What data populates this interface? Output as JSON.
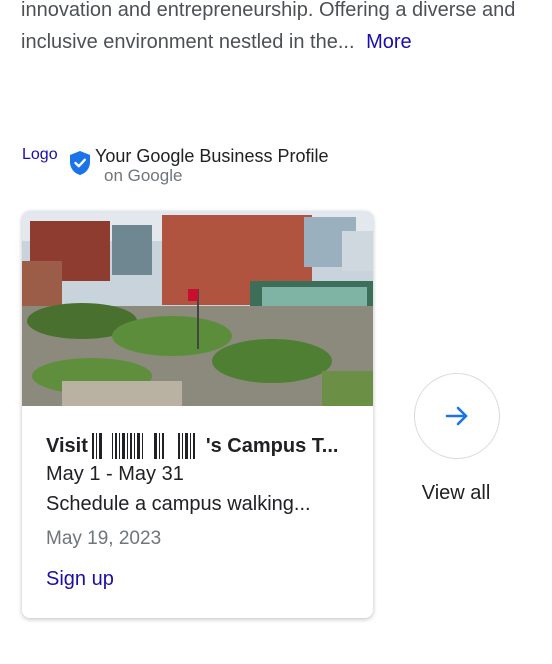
{
  "description": {
    "text": "innovation and entrepreneurship. Offering a diverse and inclusive environment nestled in the...",
    "more_label": "More"
  },
  "profile": {
    "logo_label": "Logo",
    "title": "Your Google Business Profile",
    "subtitle": "on Google",
    "badge_color": "#1a73e8"
  },
  "event_card": {
    "title_prefix": "Visit",
    "title_suffix": "'s Campus T...",
    "dates": "May 1 - May 31",
    "summary": "Schedule a campus walking...",
    "posted": "May 19, 2023",
    "signup_label": "Sign up"
  },
  "view_all": {
    "label": "View all",
    "icon": "arrow-right-icon",
    "accent": "#1a73e8"
  }
}
